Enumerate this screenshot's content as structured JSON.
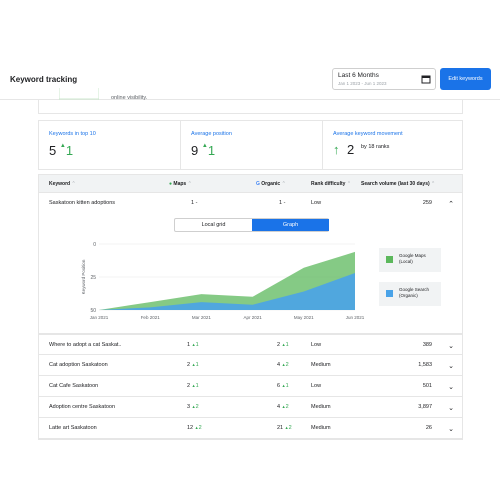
{
  "header": {
    "title": "Keyword tracking",
    "date_label": "Last 6 Months",
    "date_sub": "Jan 1 2023 - Jun 1 2023",
    "edit_label": "Edit keywords"
  },
  "top_card": {
    "text": "online visibility."
  },
  "stats": [
    {
      "heading": "Keywords in top 10",
      "value": "5",
      "delta": "1"
    },
    {
      "heading": "Average position",
      "value": "9",
      "delta": "1"
    },
    {
      "heading": "Average keyword movement",
      "value": "2",
      "note": "by 18 ranks"
    }
  ],
  "table": {
    "headers": {
      "keyword": "Keyword",
      "maps": "Maps",
      "organic": "Organic",
      "difficulty": "Rank difficulty",
      "volume": "Search volume (last 30 days)"
    },
    "expanded_row": {
      "keyword": "Saskatoon kitten adoptions",
      "maps": "1 -",
      "organic": "1 -",
      "difficulty": "Low",
      "volume": "259"
    },
    "toggle": {
      "local_grid": "Local grid",
      "graph": "Graph"
    },
    "rows": [
      {
        "keyword": "Where to adopt a cat Saskat..",
        "maps": "1",
        "maps_delta": "1",
        "organic": "2",
        "organic_delta": "1",
        "difficulty": "Low",
        "volume": "389"
      },
      {
        "keyword": "Cat adoption Saskatoon",
        "maps": "2",
        "maps_delta": "1",
        "organic": "4",
        "organic_delta": "2",
        "difficulty": "Medium",
        "volume": "1,583"
      },
      {
        "keyword": "Cat Cafe Saskatoon",
        "maps": "2",
        "maps_delta": "1",
        "organic": "6",
        "organic_delta": "1",
        "difficulty": "Low",
        "volume": "501"
      },
      {
        "keyword": "Adoption centre Saskatoon",
        "maps": "3",
        "maps_delta": "2",
        "organic": "4",
        "organic_delta": "2",
        "difficulty": "Medium",
        "volume": "3,897"
      },
      {
        "keyword": "Latte art Saskatoon",
        "maps": "12",
        "maps_delta": "2",
        "organic": "21",
        "organic_delta": "2",
        "difficulty": "Medium",
        "volume": "26"
      }
    ]
  },
  "chart_data": {
    "type": "area",
    "ylabel": "Keyword Position",
    "x": [
      "Jan 2021",
      "Feb 2021",
      "Mar 2021",
      "Apr 2021",
      "May 2021",
      "Jun 2021"
    ],
    "yticks": [
      "0",
      "25",
      "50"
    ],
    "ylim": [
      50,
      0
    ],
    "series": [
      {
        "name": "Google Maps (Local)",
        "color": "#5cb85c",
        "values": [
          50,
          44,
          38,
          40,
          18,
          6
        ]
      },
      {
        "name": "Google Search (Organic)",
        "color": "#4aa3e8",
        "values": [
          50,
          48,
          44,
          46,
          36,
          22
        ]
      }
    ]
  },
  "colors": {
    "accent": "#1a73e8",
    "positive": "#34a853"
  }
}
